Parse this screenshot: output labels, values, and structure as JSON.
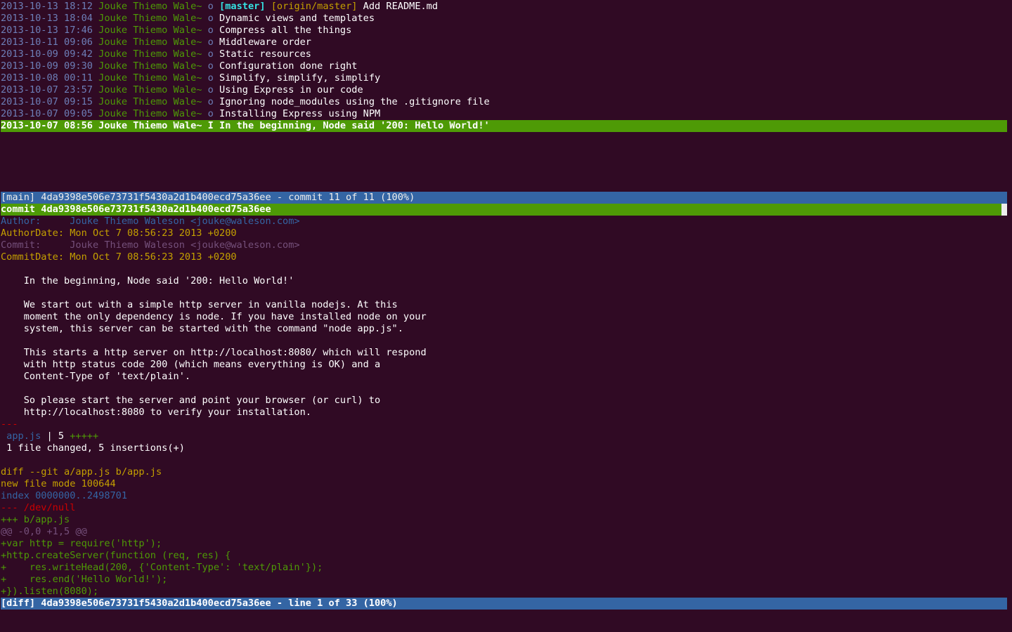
{
  "log": [
    {
      "date": "2013-10-13 18:12",
      "author": "Jouke Thiemo Wale~",
      "mark": "o",
      "refs": [
        {
          "label": "[master]",
          "kind": "branch"
        },
        {
          "label": "[origin/master]",
          "kind": "remote"
        }
      ],
      "subject": "Add README.md"
    },
    {
      "date": "2013-10-13 18:04",
      "author": "Jouke Thiemo Wale~",
      "mark": "o",
      "refs": [],
      "subject": "Dynamic views and templates"
    },
    {
      "date": "2013-10-13 17:46",
      "author": "Jouke Thiemo Wale~",
      "mark": "o",
      "refs": [],
      "subject": "Compress all the things"
    },
    {
      "date": "2013-10-11 09:06",
      "author": "Jouke Thiemo Wale~",
      "mark": "o",
      "refs": [],
      "subject": "Middleware order"
    },
    {
      "date": "2013-10-09 09:42",
      "author": "Jouke Thiemo Wale~",
      "mark": "o",
      "refs": [],
      "subject": "Static resources"
    },
    {
      "date": "2013-10-09 09:30",
      "author": "Jouke Thiemo Wale~",
      "mark": "o",
      "refs": [],
      "subject": "Configuration done right"
    },
    {
      "date": "2013-10-08 00:11",
      "author": "Jouke Thiemo Wale~",
      "mark": "o",
      "refs": [],
      "subject": "Simplify, simplify, simplify"
    },
    {
      "date": "2013-10-07 23:57",
      "author": "Jouke Thiemo Wale~",
      "mark": "o",
      "refs": [],
      "subject": "Using Express in our code"
    },
    {
      "date": "2013-10-07 09:15",
      "author": "Jouke Thiemo Wale~",
      "mark": "o",
      "refs": [],
      "subject": "Ignoring node_modules using the .gitignore file"
    },
    {
      "date": "2013-10-07 09:05",
      "author": "Jouke Thiemo Wale~",
      "mark": "o",
      "refs": [],
      "subject": "Installing Express using NPM"
    },
    {
      "date": "2013-10-07 08:56",
      "author": "Jouke Thiemo Wale~",
      "mark": "I",
      "refs": [],
      "subject": "In the beginning, Node said '200: Hello World!'",
      "selected": true
    }
  ],
  "main_status": "[main] 4da9398e506e73731f5430a2d1b400ecd75a36ee - commit 11 of 11 (100%)",
  "commit_line": "commit 4da9398e506e73731f5430a2d1b400ecd75a36ee",
  "author_label": "Author:     ",
  "author_value": "Jouke Thiemo Waleson <jouke@waleson.com>",
  "authordate_label": "AuthorDate: ",
  "authordate_value": "Mon Oct 7 08:56:23 2013 +0200",
  "committer_label": "Commit:     ",
  "committer_value": "Jouke Thiemo Waleson <jouke@waleson.com>",
  "commitdate_label": "CommitDate: ",
  "commitdate_value": "Mon Oct 7 08:56:23 2013 +0200",
  "message": [
    "    In the beginning, Node said '200: Hello World!'",
    "",
    "    We start out with a simple http server in vanilla nodejs. At this",
    "    moment the only dependency is node. If you have installed node on your",
    "    system, this server can be started with the command \"node app.js\".",
    "",
    "    This starts a http server on http://localhost:8080/ which will respond",
    "    with http status code 200 (which means everything is OK) and a",
    "    Content-Type of 'text/plain'.",
    "",
    "    So please start the server and point your browser (or curl) to",
    "    http://localhost:8080 to verify your installation."
  ],
  "separator": "---",
  "stat_file": " app.js",
  "stat_mid": " | 5 ",
  "stat_plus": "+++++",
  "stat_summary": " 1 file changed, 5 insertions(+)",
  "diff_header": "diff --git a/app.js b/app.js",
  "diff_mode": "new file mode 100644",
  "diff_index": "index 0000000..2498701",
  "diff_minus": "--- /dev/null",
  "diff_plus": "+++ b/app.js",
  "diff_hunk": "@@ -0,0 +1,5 @@",
  "diff_lines": [
    "+var http = require('http');",
    "+http.createServer(function (req, res) {",
    "+    res.writeHead(200, {'Content-Type': 'text/plain'});",
    "+    res.end('Hello World!');",
    "+}).listen(8080);"
  ],
  "diff_status": "[diff] 4da9398e506e73731f5430a2d1b400ecd75a36ee - line 1 of 33 (100%)"
}
